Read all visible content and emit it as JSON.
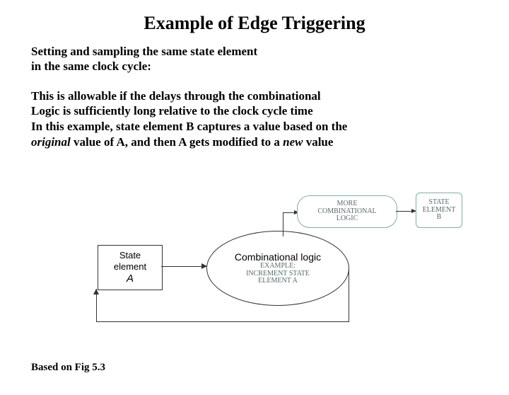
{
  "title": "Example of Edge Triggering",
  "intro_l1": "Setting and sampling the same state element",
  "intro_l2": "in the same clock cycle:",
  "body_l1": "This is allowable if the delays through the combinational",
  "body_l2": "Logic is sufficiently long relative to the clock cycle time",
  "body_l3": "In this example, state element B captures a value based on the",
  "body_l4a": "original",
  "body_l4b": " value of A, and then A gets modified to a ",
  "body_l4c": "new",
  "body_l4d": " value",
  "footer": "Based on Fig 5.3",
  "diagram": {
    "state_label1": "State",
    "state_label2": "element",
    "state_letter": "A",
    "comb_label": "Combinational logic",
    "comb_hand1": "EXAMPLE:",
    "comb_hand2": "INCREMENT STATE",
    "comb_hand3": "ELEMENT A",
    "cloud1_l1": "MORE",
    "cloud1_l2": "COMBINATIONAL",
    "cloud1_l3": "LOGIC",
    "cloud2_l1": "STATE",
    "cloud2_l2": "ELEMENT",
    "cloud2_l3": "B"
  }
}
